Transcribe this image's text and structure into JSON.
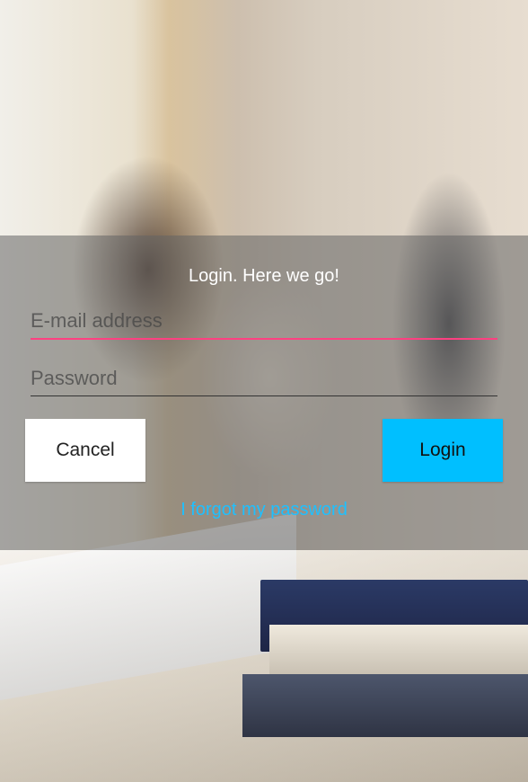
{
  "dialog": {
    "title": "Login. Here we go!",
    "email_placeholder": "E-mail address",
    "password_placeholder": "Password",
    "cancel_label": "Cancel",
    "login_label": "Login",
    "forgot_link": "I forgot my password"
  },
  "colors": {
    "accent_pink": "#ff4081",
    "login_button": "#00bfff",
    "link_blue": "#1ec0ff"
  }
}
